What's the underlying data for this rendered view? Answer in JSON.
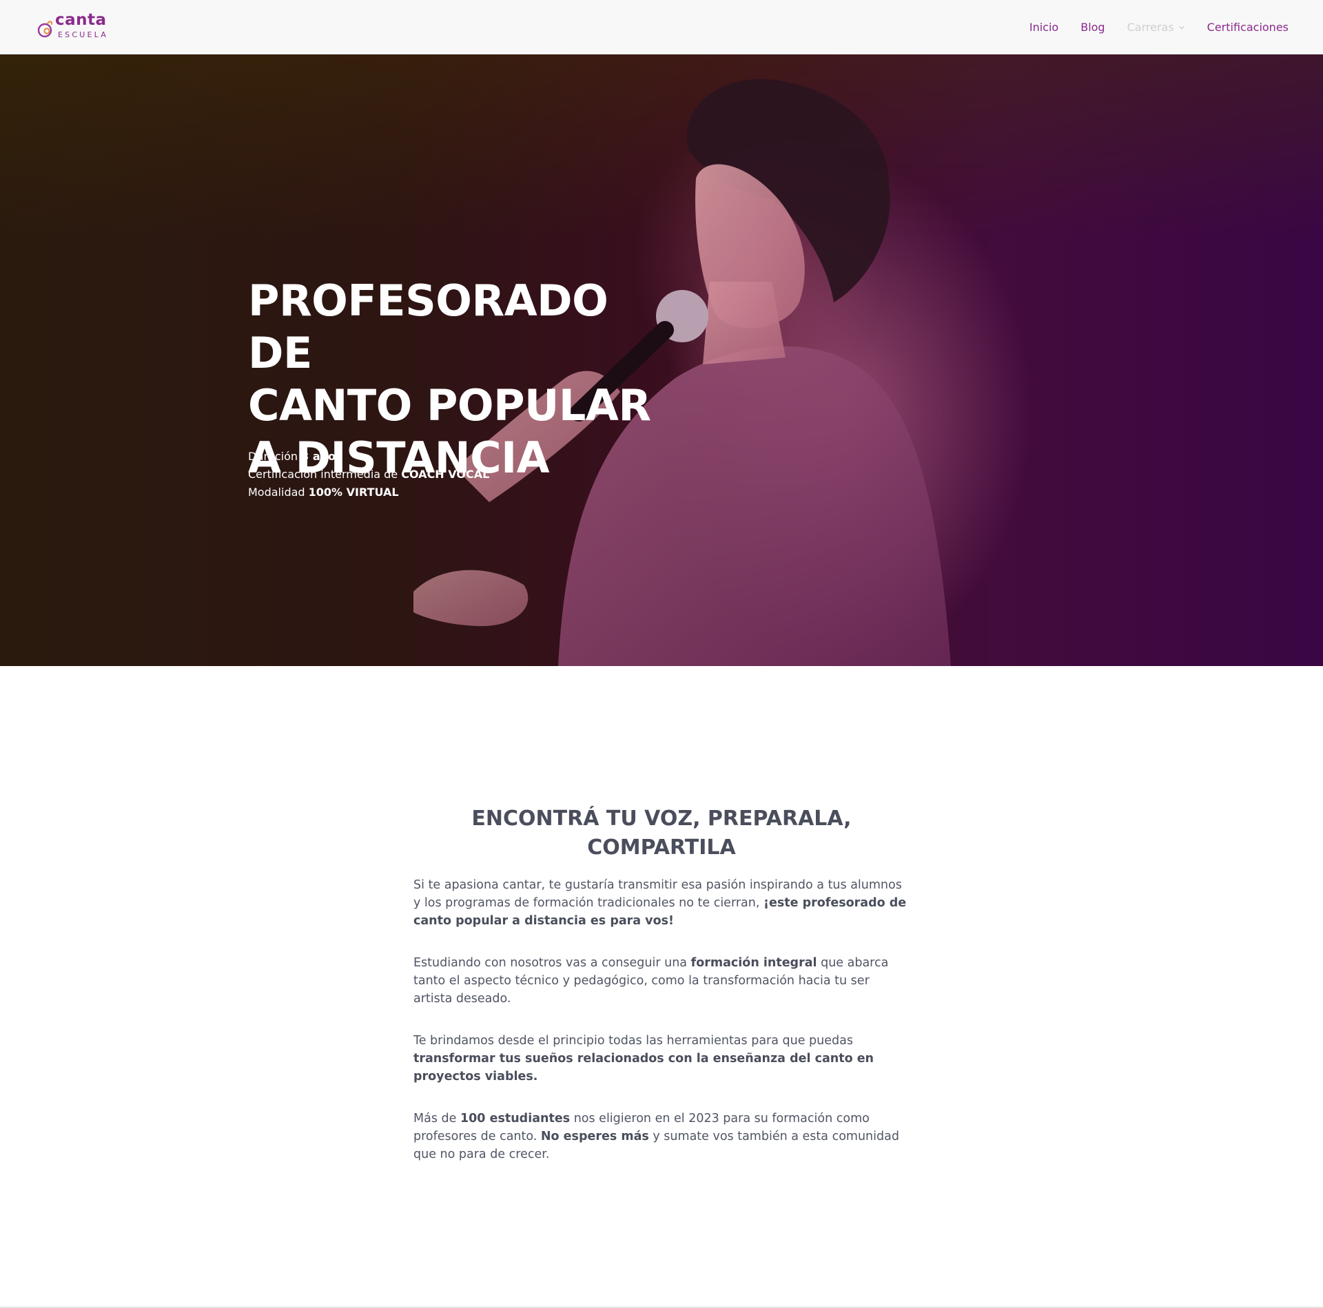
{
  "brand": {
    "logo_word": "canta",
    "logo_sub": "ESCUELA",
    "accent": "#8a2a8c"
  },
  "nav": {
    "items": [
      {
        "label": "Inicio"
      },
      {
        "label": "Blog"
      },
      {
        "label": "Carreras",
        "has_dropdown": true,
        "icon": "chevron-down-icon"
      },
      {
        "label": "Certificaciones"
      }
    ]
  },
  "hero": {
    "title_lines": [
      "PROFESORADO DE",
      "CANTO POPULAR",
      "A DISTANCIA"
    ],
    "facts": [
      {
        "prefix": "Duración ",
        "strong": "3 años"
      },
      {
        "prefix": "Certificación intermedia de ",
        "strong": "COACH VOCAL"
      },
      {
        "prefix": "Modalidad ",
        "strong": "100% VIRTUAL"
      }
    ]
  },
  "intro": {
    "title_lines": [
      "ENCONTRÁ TU VOZ, PREPARALA,",
      "COMPARTILA"
    ],
    "paragraphs": [
      {
        "parts": [
          {
            "text": "Si te apasiona cantar, te gustaría transmitir esa pasión inspirando a tus alumnos y los programas de formación tradicionales no te cierran, ",
            "bold": false
          },
          {
            "text": "¡este profesorado de canto popular a distancia es para vos!",
            "bold": true
          }
        ]
      },
      {
        "parts": [
          {
            "text": "Estudiando con nosotros vas a conseguir una ",
            "bold": false
          },
          {
            "text": "formación integral",
            "bold": true
          },
          {
            "text": " que abarca tanto el aspecto técnico y pedagógico, como la transformación hacia tu ser artista deseado.",
            "bold": false
          }
        ]
      },
      {
        "parts": [
          {
            "text": "Te brindamos desde el principio todas las herramientas para que puedas ",
            "bold": false
          },
          {
            "text": "transformar tus sueños relacionados con la enseñanza del canto en proyectos viables.",
            "bold": true
          }
        ]
      },
      {
        "parts": [
          {
            "text": "Más de ",
            "bold": false
          },
          {
            "text": "100 estudiantes",
            "bold": true
          },
          {
            "text": " nos eligieron en el 2023 para su formación como profesores de canto. ",
            "bold": false
          },
          {
            "text": "No esperes más",
            "bold": true
          },
          {
            "text": " y sumate vos también a esta comunidad que no para de crecer.",
            "bold": false
          }
        ]
      }
    ]
  }
}
